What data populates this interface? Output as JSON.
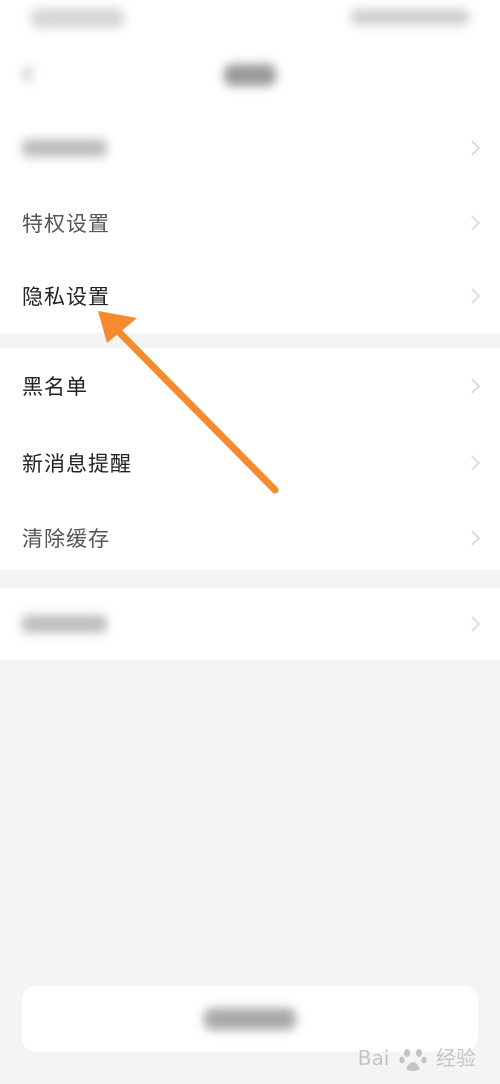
{
  "settings": {
    "group1": {
      "items": [
        {
          "label": "特权设置"
        },
        {
          "label": "隐私设置"
        }
      ]
    },
    "group2": {
      "items": [
        {
          "label": "黑名单"
        },
        {
          "label": "新消息提醒"
        },
        {
          "label": "清除缓存"
        }
      ]
    }
  },
  "annotation": {
    "arrow_color": "#f58a2e"
  },
  "watermark": {
    "brand_left": "Bai",
    "brand_right": "经验",
    "icon": "paw-icon"
  },
  "colors": {
    "background": "#f4f4f4",
    "panel": "#ffffff",
    "text": "#222222"
  }
}
